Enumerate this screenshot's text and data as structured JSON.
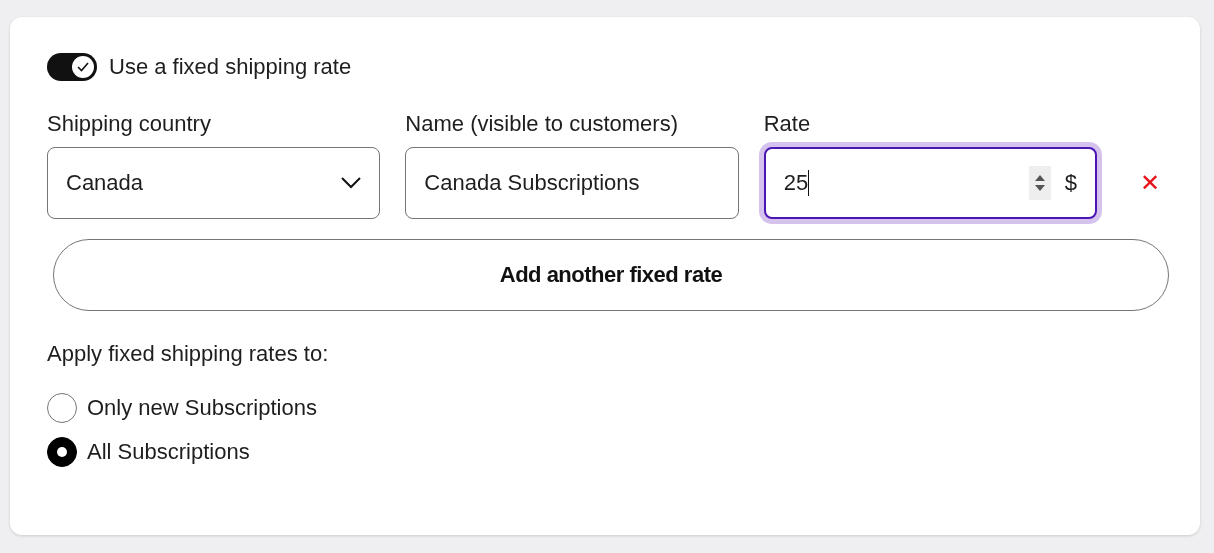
{
  "toggle": {
    "label": "Use a fixed shipping rate",
    "on": true
  },
  "rates": [
    {
      "country_label": "Shipping country",
      "country": "Canada",
      "name_label": "Name (visible to customers)",
      "name": "Canada Subscriptions",
      "rate_label": "Rate",
      "rate": "25",
      "currency": "$",
      "focused": true,
      "remove": "✕"
    }
  ],
  "add_button": "Add another fixed rate",
  "apply": {
    "label": "Apply fixed shipping rates to:",
    "options": [
      {
        "label": "Only new Subscriptions",
        "selected": false
      },
      {
        "label": "All Subscriptions",
        "selected": true
      }
    ]
  }
}
